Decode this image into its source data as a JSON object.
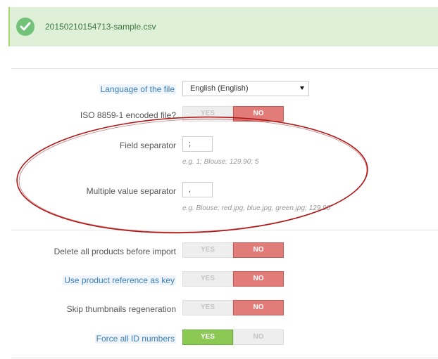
{
  "alert": {
    "filename": "20150210154713-sample.csv",
    "icon": "check-circle-icon"
  },
  "language": {
    "label": "Language of the file",
    "value": "English (English)"
  },
  "iso": {
    "label": "ISO 8859-1 encoded file?",
    "yes": "YES",
    "no": "NO"
  },
  "field_separator": {
    "label": "Field separator",
    "value": ";",
    "hint": "e.g. 1; Blouse; 129.90; 5"
  },
  "multiple_separator": {
    "label": "Multiple value separator",
    "value": ",",
    "hint": "e.g. Blouse; red.jpg, blue.jpg, green.jpg; 129.90"
  },
  "delete_all": {
    "label": "Delete all products before import",
    "yes": "YES",
    "no": "NO"
  },
  "use_reference": {
    "label": "Use product reference as key",
    "yes": "YES",
    "no": "NO"
  },
  "skip_thumbnails": {
    "label": "Skip thumbnails regeneration",
    "yes": "YES",
    "no": "NO"
  },
  "force_ids": {
    "label": "Force all ID numbers",
    "yes": "YES",
    "no": "NO"
  },
  "colors": {
    "success_bg": "#dff0d8",
    "no_active": "#e27c79",
    "yes_active": "#8bc954",
    "annotation": "#b01818"
  }
}
